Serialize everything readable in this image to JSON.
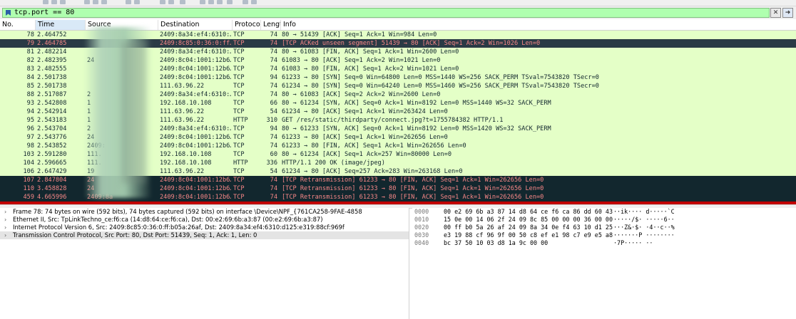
{
  "filter": {
    "value": "tcp.port == 80"
  },
  "columns": [
    "No.",
    "Time",
    "Source",
    "Destination",
    "Protocol",
    "Length",
    "Info"
  ],
  "packets": [
    {
      "no": "78",
      "time": "2.464752",
      "src": "",
      "dst": "2409:8a34:ef4:6310:…",
      "proto": "TCP",
      "len": "74",
      "info": "80 → 51439 [ACK] Seq=1 Ack=1 Win=984 Len=0",
      "style": "green"
    },
    {
      "no": "79",
      "time": "2.464785",
      "src": "",
      "dst": "2409:8c85:0:36:0:ff…",
      "proto": "TCP",
      "len": "74",
      "info": "[TCP ACKed unseen segment] 51439 → 80 [ACK] Seq=1 Ack=2 Win=1026 Len=0",
      "style": "black"
    },
    {
      "no": "81",
      "time": "2.482214",
      "src": "",
      "dst": "2409:8a34:ef4:6310:…",
      "proto": "TCP",
      "len": "74",
      "info": "80 → 61083 [FIN, ACK] Seq=1 Ack=1 Win=2600 Len=0",
      "style": "green"
    },
    {
      "no": "82",
      "time": "2.482395",
      "src": "24",
      "dst": "2409:8c04:1001:12b6…",
      "proto": "TCP",
      "len": "74",
      "info": "61083 → 80 [ACK] Seq=1 Ack=2 Win=1021 Len=0",
      "style": "green"
    },
    {
      "no": "83",
      "time": "2.482555",
      "src": "",
      "dst": "2409:8c04:1001:12b6…",
      "proto": "TCP",
      "len": "74",
      "info": "61083 → 80 [FIN, ACK] Seq=1 Ack=2 Win=1021 Len=0",
      "style": "green"
    },
    {
      "no": "84",
      "time": "2.501738",
      "src": "",
      "dst": "2409:8c04:1001:12b6…",
      "proto": "TCP",
      "len": "94",
      "info": "61233 → 80 [SYN] Seq=0 Win=64800 Len=0 MSS=1440 WS=256 SACK_PERM TSval=7543820 TSecr=0",
      "style": "green"
    },
    {
      "no": "85",
      "time": "2.501738",
      "src": "",
      "dst": "111.63.96.22",
      "proto": "TCP",
      "len": "74",
      "info": "61234 → 80 [SYN] Seq=0 Win=64240 Len=0 MSS=1460 WS=256 SACK_PERM TSval=7543820 TSecr=0",
      "style": "green"
    },
    {
      "no": "88",
      "time": "2.517087",
      "src": "2",
      "dst": "2409:8a34:ef4:6310:…",
      "proto": "TCP",
      "len": "74",
      "info": "80 → 61083 [ACK] Seq=2 Ack=2 Win=2600 Len=0",
      "style": "green"
    },
    {
      "no": "93",
      "time": "2.542808",
      "src": "1",
      "dst": "192.168.10.108",
      "proto": "TCP",
      "len": "66",
      "info": "80 → 61234 [SYN, ACK] Seq=0 Ack=1 Win=8192 Len=0 MSS=1440 WS=32 SACK_PERM",
      "style": "green"
    },
    {
      "no": "94",
      "time": "2.542914",
      "src": "1",
      "dst": "111.63.96.22",
      "proto": "TCP",
      "len": "54",
      "info": "61234 → 80 [ACK] Seq=1 Ack=1 Win=263424 Len=0",
      "style": "green"
    },
    {
      "no": "95",
      "time": "2.543183",
      "src": "1",
      "dst": "111.63.96.22",
      "proto": "HTTP",
      "len": "310",
      "info": "GET /res/static/thirdparty/connect.jpg?t=1755784382 HTTP/1.1",
      "style": "green"
    },
    {
      "no": "96",
      "time": "2.543704",
      "src": "2",
      "dst": "2409:8a34:ef4:6310:…",
      "proto": "TCP",
      "len": "94",
      "info": "80 → 61233 [SYN, ACK] Seq=0 Ack=1 Win=8192 Len=0 MSS=1420 WS=32 SACK_PERM",
      "style": "green"
    },
    {
      "no": "97",
      "time": "2.543776",
      "src": "24",
      "dst": "2409:8c04:1001:12b6…",
      "proto": "TCP",
      "len": "74",
      "info": "61233 → 80 [ACK] Seq=1 Ack=1 Win=262656 Len=0",
      "style": "green"
    },
    {
      "no": "98",
      "time": "2.543852",
      "src": "2409:",
      "dst": "2409:8c04:1001:12b6…",
      "proto": "TCP",
      "len": "74",
      "info": "61233 → 80 [FIN, ACK] Seq=1 Ack=1 Win=262656 Len=0",
      "style": "green"
    },
    {
      "no": "103",
      "time": "2.591280",
      "src": "111.",
      "dst": "192.168.10.108",
      "proto": "TCP",
      "len": "60",
      "info": "80 → 61234 [ACK] Seq=1 Ack=257 Win=80000 Len=0",
      "style": "green"
    },
    {
      "no": "104",
      "time": "2.596665",
      "src": "111.",
      "dst": "192.168.10.108",
      "proto": "HTTP",
      "len": "336",
      "info": "HTTP/1.1 200 OK  (image/jpeg)",
      "style": "green"
    },
    {
      "no": "106",
      "time": "2.647429",
      "src": "19",
      "dst": "111.63.96.22",
      "proto": "TCP",
      "len": "54",
      "info": "61234 → 80 [ACK] Seq=257 Ack=283 Win=263168 Len=0",
      "style": "green"
    },
    {
      "no": "107",
      "time": "2.847804",
      "src": "24",
      "dst": "2409:8c04:1001:12b6…",
      "proto": "TCP",
      "len": "74",
      "info": "[TCP Retransmission] 61233 → 80 [FIN, ACK] Seq=1 Ack=1 Win=262656 Len=0",
      "style": "black"
    },
    {
      "no": "110",
      "time": "3.458828",
      "src": "24",
      "dst": "2409:8c04:1001:12b6…",
      "proto": "TCP",
      "len": "74",
      "info": "[TCP Retransmission] 61233 → 80 [FIN, ACK] Seq=1 Ack=1 Win=262656 Len=0",
      "style": "black"
    },
    {
      "no": "459",
      "time": "4.665996",
      "src": "2409:8a",
      "dst": "2409:8c04:1001:12b6…",
      "proto": "TCP",
      "len": "74",
      "info": "[TCP Retransmission] 61233 → 80 [FIN, ACK] Seq=1 Ack=1 Win=262656 Len=0",
      "style": "black"
    }
  ],
  "details": [
    "Frame 78: 74 bytes on wire (592 bits), 74 bytes captured (592 bits) on interface \\Device\\NPF_{761CA258-9FAE-4858",
    "Ethernet II, Src: TpLinkTechno_ce:f6:ca (14:d8:64:ce:f6:ca), Dst: 00:e2:69:6b:a3:87 (00:e2:69:6b:a3:87)",
    "Internet Protocol Version 6, Src: 2409:8c85:0:36:0:ff:b05a:26af, Dst: 2409:8a34:ef4:6310:d125:e319:88cf:969f",
    "Transmission Control Protocol, Src Port: 80, Dst Port: 51439, Seq: 1, Ack: 1, Len: 0"
  ],
  "bytes": [
    {
      "offset": "0000",
      "hex": "00 e2 69 6b a3 87 14 d8  64 ce f6 ca 86 dd 60 43",
      "ascii": "··ik····  d·····`C"
    },
    {
      "offset": "0010",
      "hex": "15 0e 00 14 06 2f 24 09  8c 85 00 00 00 36 00 00",
      "ascii": "·····/$·  ·····6··"
    },
    {
      "offset": "0020",
      "hex": "00 ff b0 5a 26 af 24 09  8a 34 0e f4 63 10 d1 25",
      "ascii": "···Z&·$·  ·4··c··%"
    },
    {
      "offset": "0030",
      "hex": "e3 19 88 cf 96 9f 00 50  c8 ef e1 98 c7 e9 e5 a8",
      "ascii": "·······P  ········"
    },
    {
      "offset": "0040",
      "hex": "bc 37 50 10 03 d8 1a 9c  00 00",
      "ascii": "·7P·····  ··"
    }
  ]
}
